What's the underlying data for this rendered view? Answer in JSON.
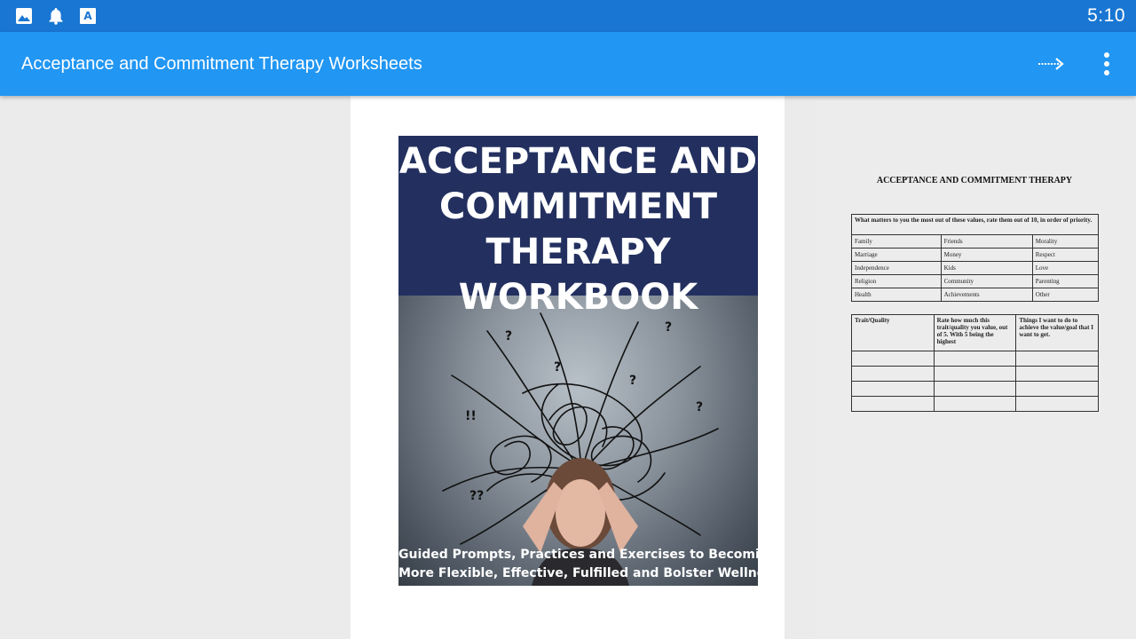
{
  "status_bar": {
    "time": "5:10",
    "icons": [
      "gallery-icon",
      "notification-bell-icon",
      "translate-icon"
    ]
  },
  "app_bar": {
    "title": "Acceptance and Commitment Therapy Worksheets",
    "actions": [
      "next-arrow-icon",
      "more-vert-icon"
    ]
  },
  "document": {
    "cover": {
      "title_lines": [
        "ACCEPTANCE AND",
        "COMMITMENT",
        "THERAPY",
        "WORKBOOK"
      ],
      "subtitle_lines": [
        "Guided Prompts, Practices and Exercises to  Becoming",
        "More Flexible, Effective, Fulfilled and Bolster Wellness"
      ]
    },
    "worksheet": {
      "heading": "ACCEPTANCE AND COMMITMENT THERAPY",
      "values_table": {
        "header": "What matters to you the most out of these values, rate them out of 10, in order of priority.",
        "rows": [
          [
            "Family",
            "Friends",
            "Morality"
          ],
          [
            "Marriage",
            "Money",
            "Respect"
          ],
          [
            "Independence",
            "Kids",
            "Love"
          ],
          [
            "Religion",
            "Community",
            "Parenting"
          ],
          [
            "Health",
            "Achievements",
            "Other"
          ]
        ]
      },
      "quality_table": {
        "headers": [
          "Trait/Quality",
          "Rate how much this trait/quality you value, out of 5. With 5 being the highest",
          "Things I want to do to achieve the value/goal that I want to get."
        ],
        "rows": [
          [
            "",
            "",
            ""
          ],
          [
            "",
            "",
            ""
          ],
          [
            "",
            "",
            ""
          ],
          [
            "",
            "",
            ""
          ]
        ]
      }
    }
  },
  "colors": {
    "status_bar": "#1976d2",
    "app_bar": "#2196f3",
    "cover_navy": "#23305f",
    "background": "#ebebeb"
  }
}
